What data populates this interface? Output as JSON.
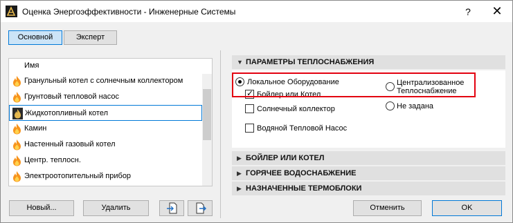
{
  "window": {
    "title": "Оценка Энергоэффективности - Инженерные Системы",
    "help_label": "?",
    "close_label": "✕"
  },
  "mode_tabs": [
    {
      "label": "Основной",
      "active": true
    },
    {
      "label": "Эксперт",
      "active": false
    }
  ],
  "list": {
    "header": "Имя",
    "items": [
      {
        "label": "Гранульный котел с солнечным коллектором",
        "icon": "flame-icon",
        "selected": false
      },
      {
        "label": "Грунтовый тепловой насос",
        "icon": "flame-icon",
        "selected": false
      },
      {
        "label": "Жидкотопливный котел",
        "icon": "flame-icon",
        "selected": true
      },
      {
        "label": "Камин",
        "icon": "flame-icon",
        "selected": false
      },
      {
        "label": "Настенный газовый котел",
        "icon": "flame-icon",
        "selected": false
      },
      {
        "label": "Центр. теплосн.",
        "icon": "flame-icon",
        "selected": false
      },
      {
        "label": "Электроотопительный прибор",
        "icon": "flame-icon",
        "selected": false
      }
    ]
  },
  "left_buttons": {
    "new_label": "Новый...",
    "delete_label": "Удалить"
  },
  "sections": {
    "heat_supply": {
      "title": "ПАРАМЕТРЫ ТЕПЛОСНАБЖЕНИЯ",
      "expanded": true,
      "radio_local": "Локальное Оборудование",
      "radio_central_line1": "Централизованное",
      "radio_central_line2": "Теплоснабжение",
      "radio_none": "Не задана",
      "check_boiler": "Бойлер или Котел",
      "check_solar": "Солнечный коллектор",
      "check_heatpump": "Водяной Тепловой Насос"
    },
    "boiler": {
      "title": "БОЙЛЕР ИЛИ КОТЕЛ",
      "expanded": false
    },
    "hot_water": {
      "title": "ГОРЯЧЕЕ ВОДОСНАБЖЕНИЕ",
      "expanded": false
    },
    "thermal_blocks": {
      "title": "НАЗНАЧЕННЫЕ ТЕРМОБЛОКИ",
      "expanded": false
    }
  },
  "footer": {
    "cancel_label": "Отменить",
    "ok_label": "OK"
  },
  "colors": {
    "accent": "#0078d7",
    "highlight_box": "#e3000f",
    "section_bg": "#e0e0e0"
  }
}
